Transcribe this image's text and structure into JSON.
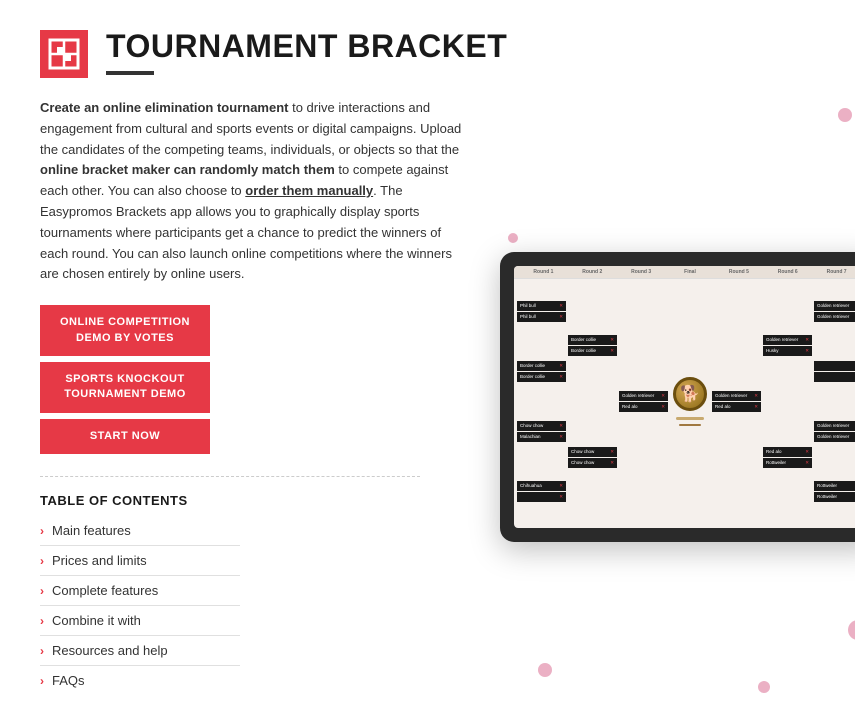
{
  "header": {
    "title": "TOURNAMENT BRACKET"
  },
  "description": {
    "part1": "Create an online elimination tournament",
    "part2": " to drive interactions and engagement from cultural and sports events or digital campaigns. Upload the candidates of the competing teams, individuals, or objects so that the ",
    "part3": "online bracket maker can randomly match them",
    "part4": " to compete against each other. You can also choose to ",
    "part5": "order them manually",
    "part6": ". The Easypromos Brackets app allows you to graphically display sports tournaments where participants get a chance to predict the winners of each round. You can also launch online competitions where the winners are chosen entirely by online users."
  },
  "buttons": [
    {
      "label": "ONLINE COMPETITION\nDEMO BY VOTES",
      "id": "demo-votes"
    },
    {
      "label": "SPORTS KNOCKOUT\nTOURNAMENT DEMO",
      "id": "demo-knockout"
    },
    {
      "label": "START NOW",
      "id": "start-now"
    }
  ],
  "toc": {
    "title": "TABLE OF CONTENTS",
    "items": [
      {
        "label": "Main features"
      },
      {
        "label": "Prices and limits"
      },
      {
        "label": "Complete features"
      },
      {
        "label": "Combine it with"
      },
      {
        "label": "Resources and help"
      },
      {
        "label": "FAQs"
      }
    ]
  },
  "bracket": {
    "rounds": [
      "Round 1",
      "Round 2",
      "Round 3",
      "Final",
      "Round 5",
      "Round 6",
      "Round 7"
    ]
  }
}
